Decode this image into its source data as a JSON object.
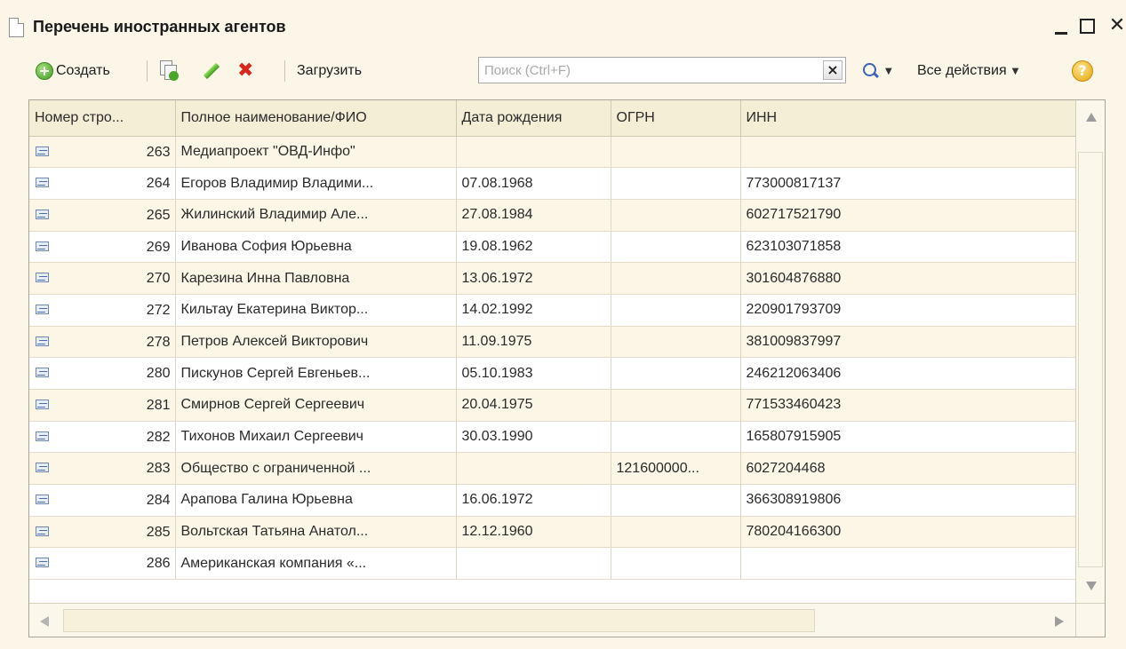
{
  "window": {
    "title": "Перечень иностранных агентов",
    "close_glyph": "✕"
  },
  "toolbar": {
    "create_label": "Создать",
    "load_label": "Загрузить",
    "search_placeholder": "Поиск (Ctrl+F)",
    "search_value": "",
    "clear_glyph": "×",
    "all_actions_label": "Все действия",
    "help_glyph": "?",
    "delete_glyph": "✖"
  },
  "icons": {
    "create": "add-circle-icon",
    "copy": "copy-icon",
    "edit": "pencil-icon",
    "delete": "delete-cross-icon",
    "search": "magnifier-icon",
    "help": "help-icon",
    "row": "catalog-item-icon"
  },
  "colors": {
    "background": "#fbf6e7",
    "header": "#f5eed6",
    "alt_row": "#fbf6e6",
    "delete_red": "#d8281d",
    "add_green": "#3f9d25"
  },
  "grid": {
    "columns": [
      "Номер стро...",
      "Полное наименование/ФИО",
      "Дата рождения",
      "ОГРН",
      "ИНН"
    ],
    "rows": [
      [
        "263",
        "Медиапроект \"ОВД-Инфо\"",
        "",
        "",
        ""
      ],
      [
        "264",
        "Егоров Владимир Владими...",
        "07.08.1968",
        "",
        "773000817137"
      ],
      [
        "265",
        "Жилинский Владимир Але...",
        "27.08.1984",
        "",
        "602717521790"
      ],
      [
        "269",
        "Иванова София Юрьевна",
        "19.08.1962",
        "",
        "623103071858"
      ],
      [
        "270",
        "Карезина Инна Павловна",
        "13.06.1972",
        "",
        "301604876880"
      ],
      [
        "272",
        "Кильтау Екатерина Виктор...",
        "14.02.1992",
        "",
        "220901793709"
      ],
      [
        "278",
        "Петров Алексей Викторович",
        "11.09.1975",
        "",
        "381009837997"
      ],
      [
        "280",
        "Пискунов Сергей Евгеньев...",
        "05.10.1983",
        "",
        "246212063406"
      ],
      [
        "281",
        "Смирнов Сергей Сергеевич",
        "20.04.1975",
        "",
        "771533460423"
      ],
      [
        "282",
        "Тихонов Михаил Сергеевич",
        "30.03.1990",
        "",
        "165807915905"
      ],
      [
        "283",
        "Общество с ограниченной ...",
        "",
        "121600000...",
        "6027204468"
      ],
      [
        "284",
        "Арапова Галина Юрьевна",
        "16.06.1972",
        "",
        "366308919806"
      ],
      [
        "285",
        "Вольтская Татьяна Анатол...",
        "12.12.1960",
        "",
        "780204166300"
      ],
      [
        "286",
        "Американская компания «...",
        "",
        "",
        ""
      ]
    ]
  }
}
